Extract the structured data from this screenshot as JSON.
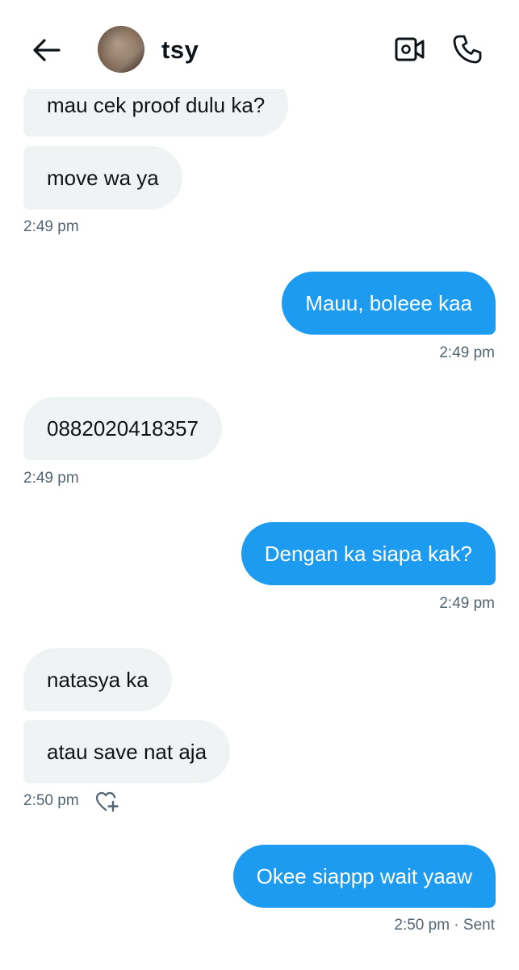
{
  "header": {
    "contact_name": "tsy",
    "back_icon": "arrow-left-icon",
    "video_icon": "video-camera-icon",
    "call_icon": "phone-icon"
  },
  "messages": [
    {
      "direction": "in",
      "text": "mau cek proof dulu ka?"
    },
    {
      "direction": "in",
      "text": "move wa ya",
      "time": "2:49 pm"
    },
    {
      "direction": "out",
      "text": "Mauu, boleee kaa",
      "time": "2:49 pm"
    },
    {
      "direction": "in",
      "text": "0882020418357",
      "time": "2:49 pm"
    },
    {
      "direction": "out",
      "text": "Dengan ka siapa kak?",
      "time": "2:49 pm"
    },
    {
      "direction": "in",
      "text": "natasya ka"
    },
    {
      "direction": "in",
      "text": "atau save nat aja",
      "time": "2:50 pm",
      "reaction_icon": "heart-plus-icon"
    },
    {
      "direction": "out",
      "text": "Okee siappp wait yaaw",
      "time": "2:50 pm · Sent"
    }
  ],
  "colors": {
    "outgoing_bubble": "#1d9bf0",
    "incoming_bubble": "#eff3f4",
    "timestamp": "#536471"
  }
}
